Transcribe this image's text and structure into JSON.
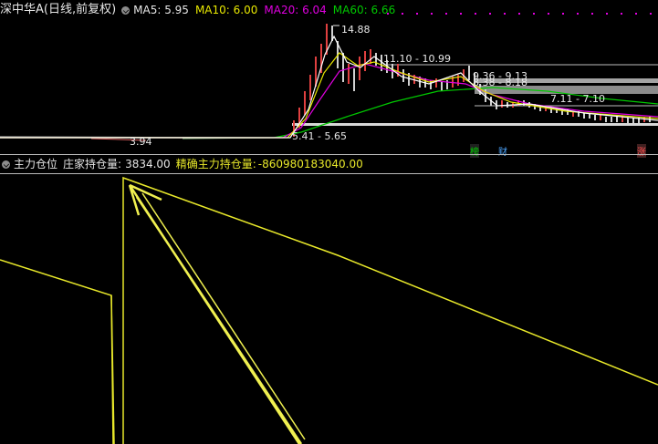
{
  "header": {
    "title": "深中华A(日线,前复权)",
    "ma5_label": "MA5: 5.95",
    "ma10_label": "MA10: 6.00",
    "ma20_label": "MA20: 6.04",
    "ma60_label": "MA60: 6.66",
    "colors": {
      "ma5": "#ffffff",
      "ma10": "#e8e800",
      "ma20": "#e000e0",
      "ma60": "#00c800",
      "dots": "#e000e0"
    }
  },
  "price_panel": {
    "annotations": {
      "high": "14.88",
      "band1": "11.10 - 10.99",
      "band2a": "9.36 - 9.13",
      "band2b": "8.38 - 8.18",
      "band3": "7.11 - 7.10",
      "low_band": "5.41 - 5.65",
      "low": "3.94"
    },
    "markers": {
      "m1": "榜",
      "m2": "财",
      "m3": "涨"
    }
  },
  "indicator_panel": {
    "title": "主力仓位",
    "holding_label": "庄家持仓量:",
    "holding_value": "3834.00",
    "precise_label": "精确主力持仓量:",
    "precise_value": "-860980183040.00",
    "line_color": "#e8e82a"
  }
}
